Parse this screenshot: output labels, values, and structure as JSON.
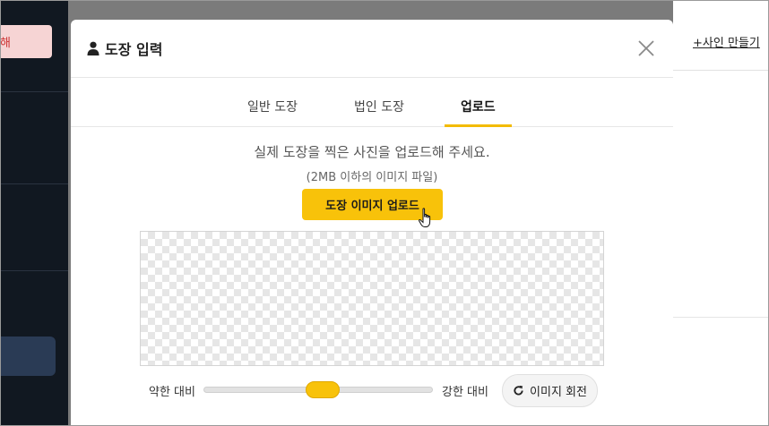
{
  "background": {
    "red_button_label": "해",
    "create_sign_link": "+사인 만들기"
  },
  "modal": {
    "title": "도장 입력",
    "user_icon": "user-icon",
    "close_icon": "close-icon",
    "tabs": [
      {
        "label": "일반 도장",
        "active": false
      },
      {
        "label": "법인 도장",
        "active": false
      },
      {
        "label": "업로드",
        "active": true
      }
    ],
    "instruction": "실제 도장을 찍은 사진을 업로드해 주세요.",
    "size_limit": "(2MB 이하의 이미지 파일)",
    "upload_button_label": "도장 이미지 업로드",
    "contrast": {
      "weak_label": "약한 대비",
      "strong_label": "강한 대비",
      "value_percent": 50
    },
    "rotate_button_label": "이미지 회전"
  },
  "colors": {
    "accent": "#f8c20a",
    "tab_underline": "#f3bb00"
  }
}
